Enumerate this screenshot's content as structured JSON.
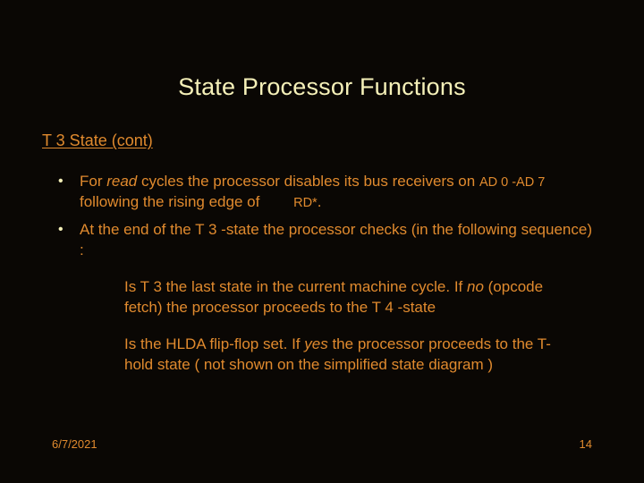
{
  "title": "State Processor Functions",
  "subtitle": "T 3 State (cont)",
  "bullets": [
    {
      "pre": "For ",
      "em": "read",
      "mid": "  cycles the processor disables its bus receivers on ",
      "sm1": "AD 0 -AD 7",
      "mid2": " following the rising edge of ",
      "gap": "       ",
      "sm2": "RD*",
      "tail": "."
    },
    {
      "text": "At the end of the T 3 -state the processor checks (in the following sequence) :"
    }
  ],
  "sub1": {
    "a": "Is T 3 the last state in the current machine cycle. If ",
    "em": "no",
    "b": "  (opcode fetch) the processor proceeds to the T 4 -state"
  },
  "sub2": {
    "a": "Is the  HLDA  flip-flop set. If  ",
    "em": "yes",
    "b": "  the processor proceeds to the  T-hold state ( not shown on the simplified state diagram )"
  },
  "footer": {
    "date": "6/7/2021",
    "page": "14"
  }
}
